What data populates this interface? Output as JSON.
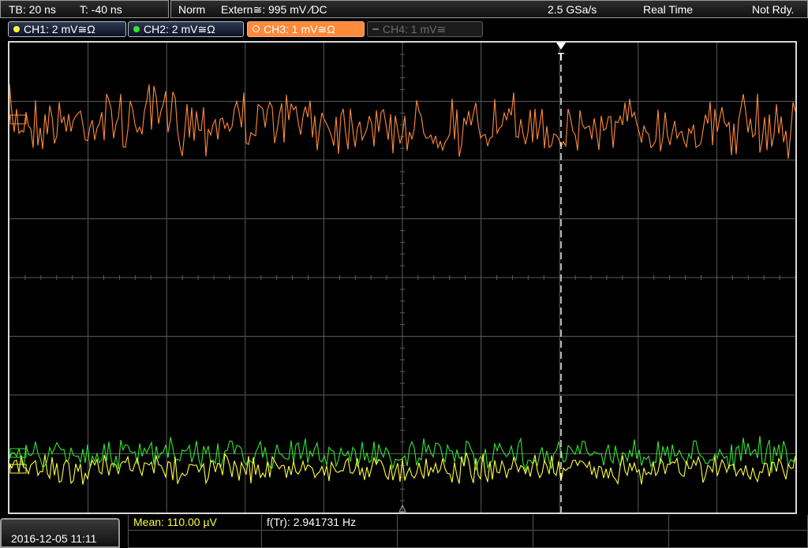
{
  "status_bar": {
    "timebase": "TB: 20 ns",
    "trigger_time": "T: -40 ns",
    "trigger_mode": "Norm",
    "trigger_source": "Extern≅: 995 mV ⁄DC",
    "sample_rate": "2.5 GSa/s",
    "acquisition": "Real Time",
    "status": "Not Rdy."
  },
  "channels": [
    {
      "label": "CH1: 2 mV≅Ω",
      "color": "#ffff3a",
      "state": "on"
    },
    {
      "label": "CH2: 2 mV≅Ω",
      "color": "#32e632",
      "state": "on"
    },
    {
      "label": "CH3: 1 mV≅Ω",
      "color": "#ff8a3a",
      "state": "selected"
    },
    {
      "label": "CH4: 1 mV≅",
      "color": "#6d6d6d",
      "state": "off"
    }
  ],
  "trigger_marker": "T",
  "datetime": "2016-12-05 11:11",
  "measurements": {
    "mean": "Mean: 110.00 µV",
    "freq": "f(Tr): 2.941731 Hz"
  },
  "colors": {
    "ch1": "#ffff3a",
    "ch2": "#32e632",
    "ch3": "#ff8a3a",
    "grid": "#5a5a5a",
    "trigger_line": "#ffffff"
  },
  "icons": {
    "trigger_marker": "down-triangle",
    "ground_marker": "up-triangle-outline"
  }
}
